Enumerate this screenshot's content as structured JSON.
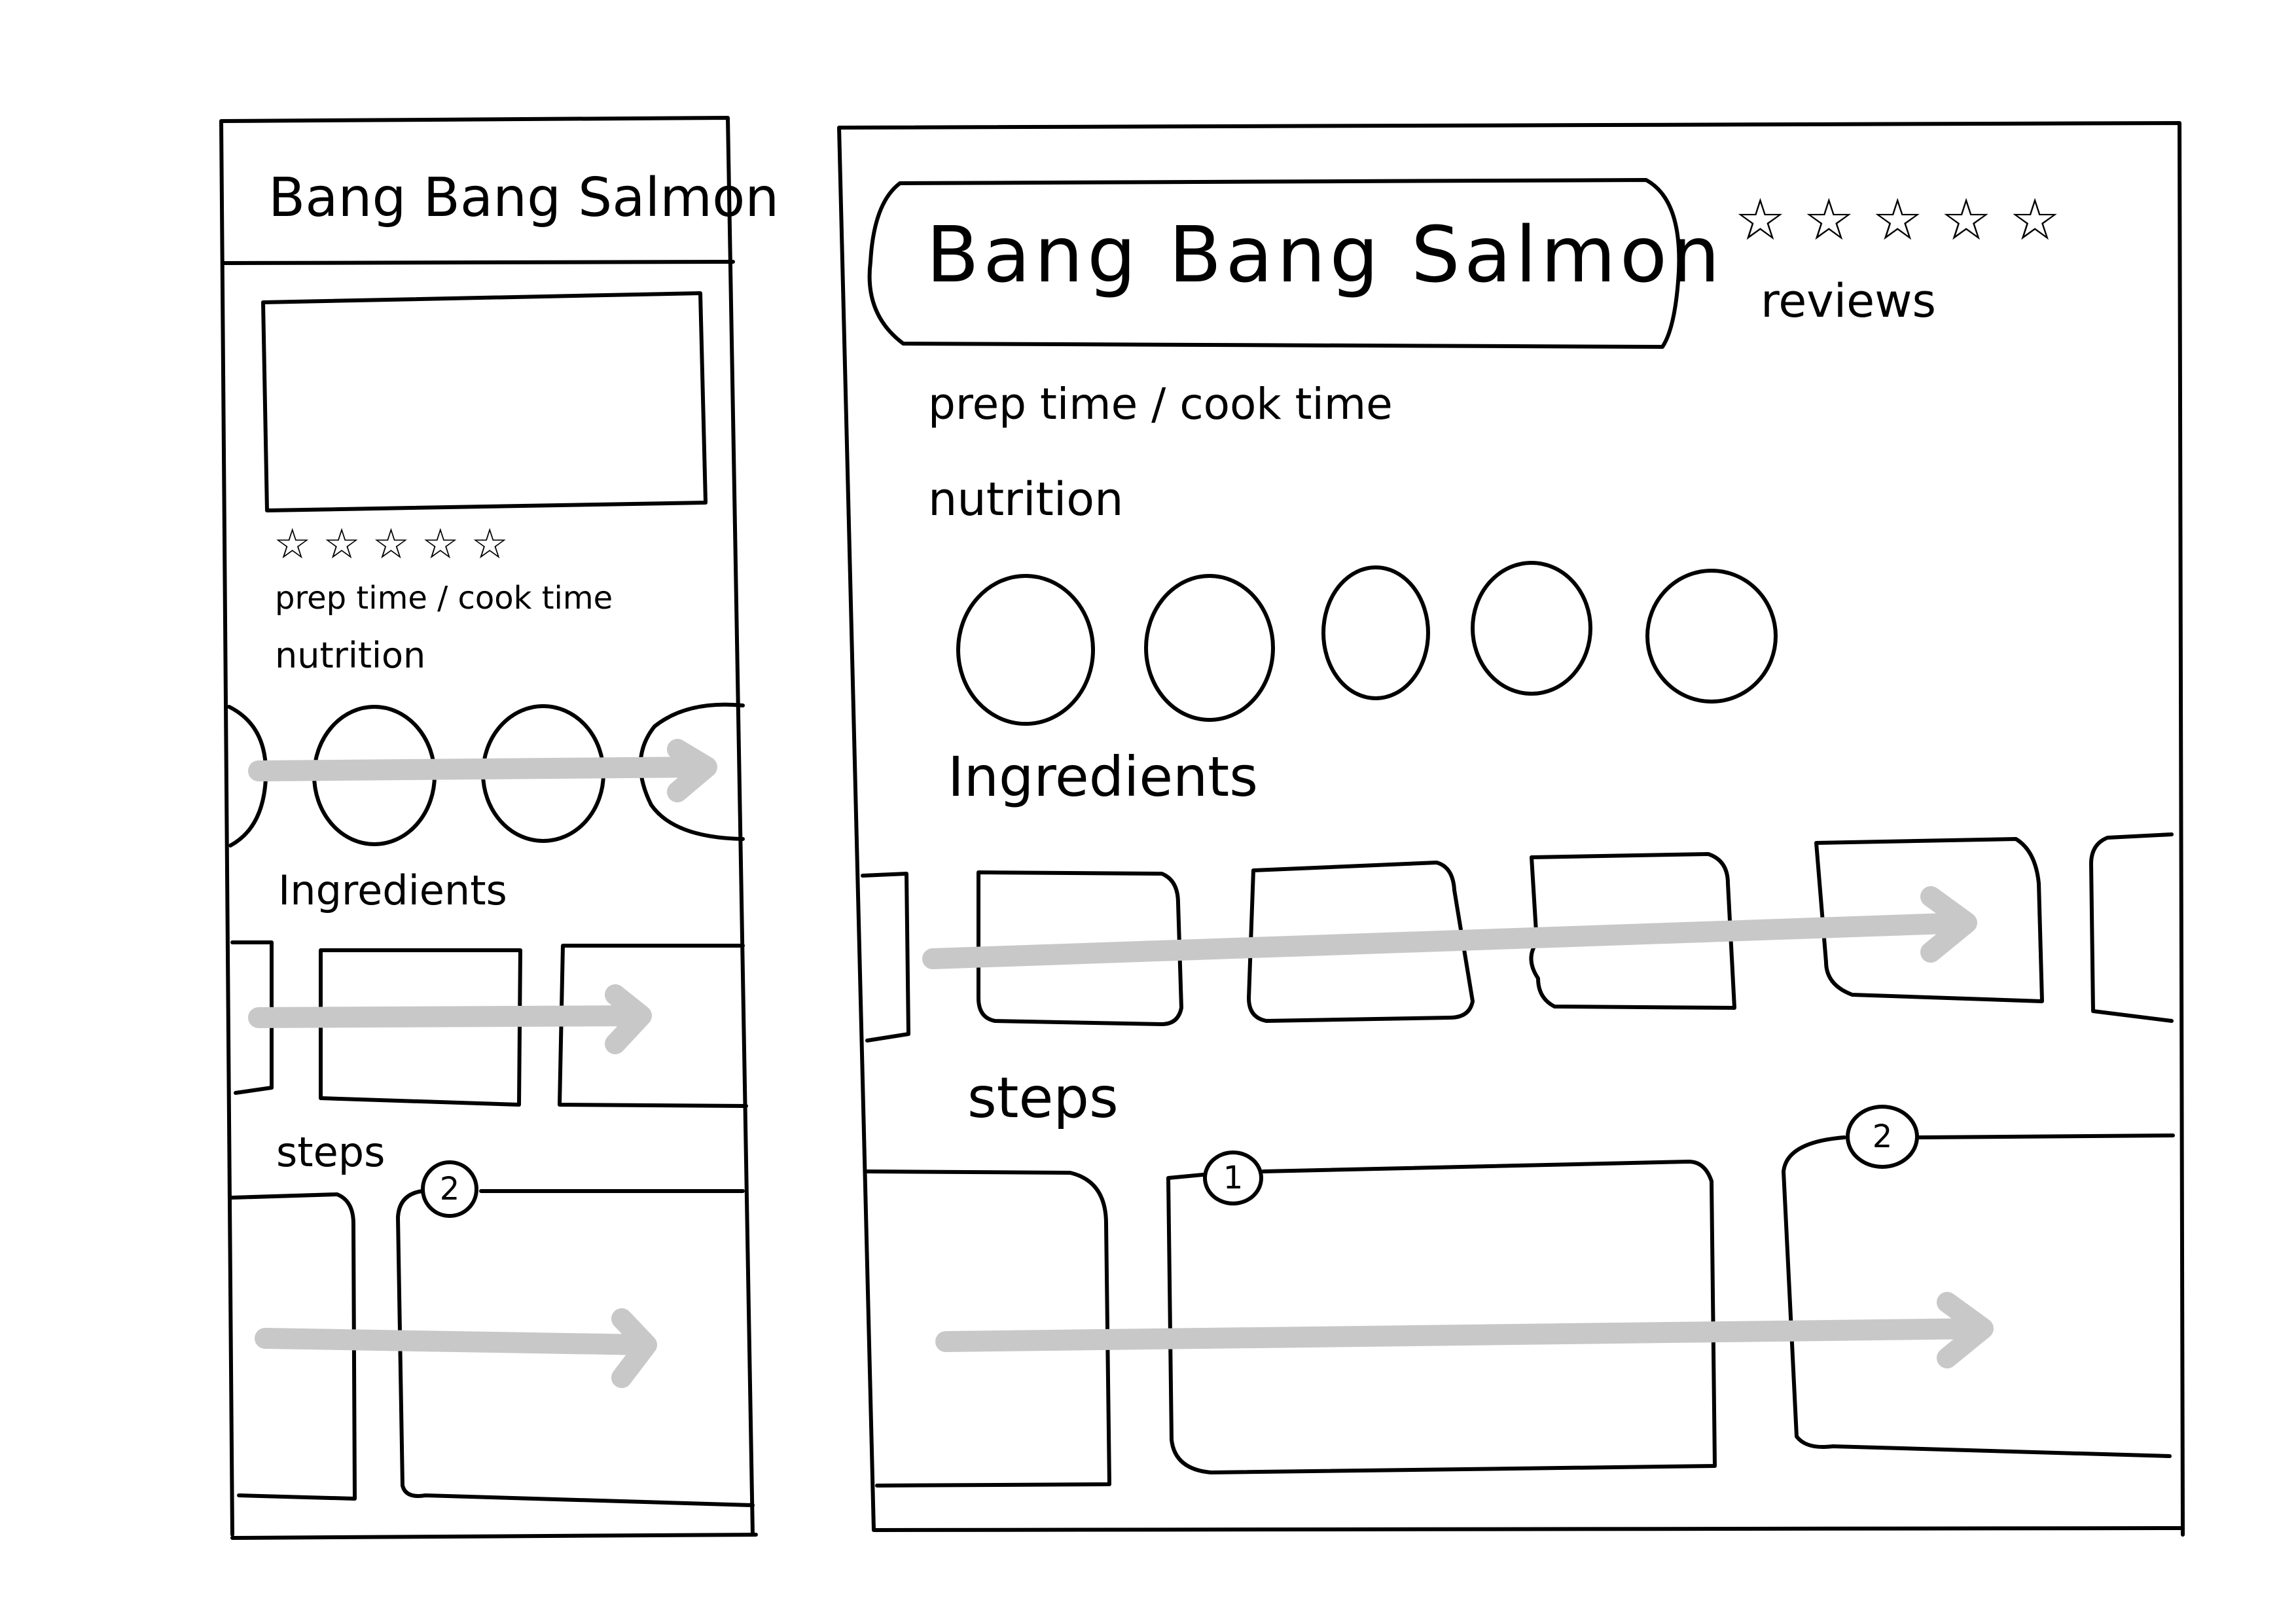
{
  "mobile": {
    "title": "Bang Bang Salmon",
    "stars": "☆☆☆☆☆",
    "prep_cook": "prep time / cook time",
    "nutrition": "nutrition",
    "ingredients": "Ingredients",
    "steps": "steps",
    "step_badge": "2"
  },
  "desktop": {
    "title": "Bang Bang Salmon",
    "stars": "☆☆☆☆☆",
    "reviews": "reviews",
    "prep_cook": "prep time / cook time",
    "nutrition": "nutrition",
    "ingredients": "Ingredients",
    "steps": "steps",
    "step_badge_1": "1",
    "step_badge_2": "2"
  },
  "colors": {
    "ink": "#000000",
    "scroll_arrow": "#c8c8c8",
    "background": "#ffffff"
  }
}
